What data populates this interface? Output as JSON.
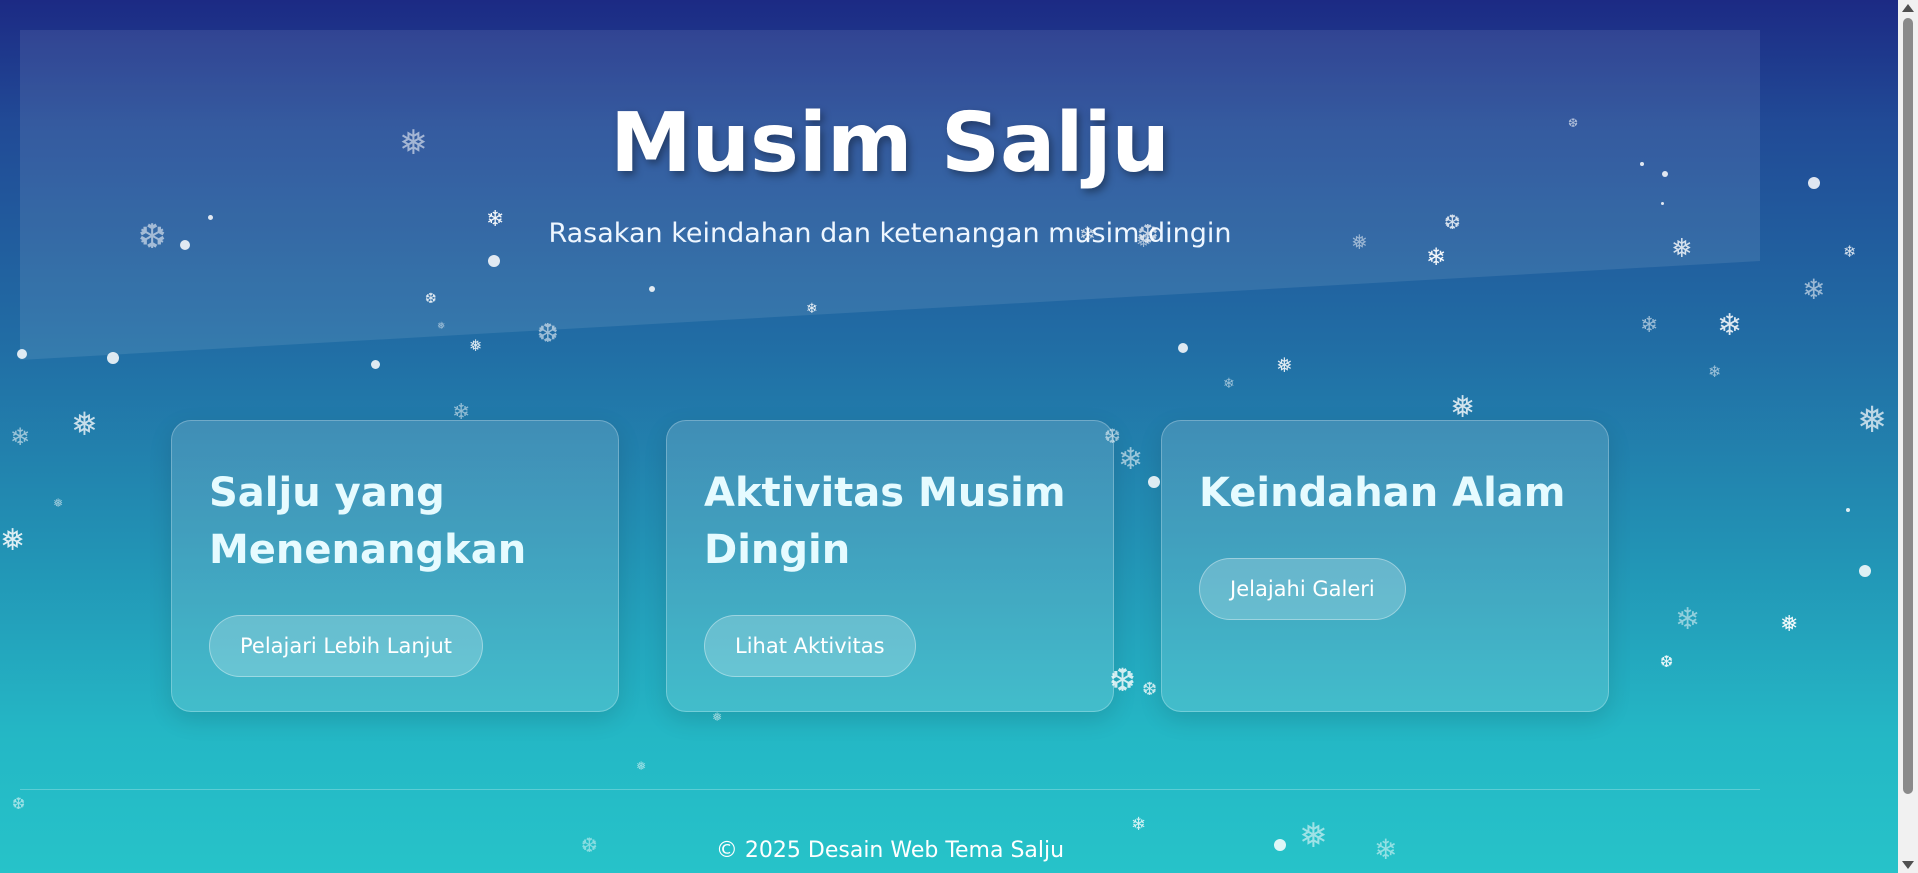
{
  "hero": {
    "title": "Musim Salju",
    "subtitle": "Rasakan keindahan dan ketenangan musim dingin"
  },
  "cards": [
    {
      "title": "Salju yang Menenangkan",
      "button": "Pelajari Lebih Lanjut"
    },
    {
      "title": "Aktivitas Musim Dingin",
      "button": "Lihat Aktivitas"
    },
    {
      "title": "Keindahan Alam",
      "button": "Jelajahi Galeri"
    }
  ],
  "footer": {
    "text": "© 2025 Desain Web Tema Salju"
  },
  "icons": {
    "snowflake": "❄",
    "snowflake_alt": "❅",
    "snowflake_heavy": "❆"
  },
  "colors": {
    "gradient_top": "#1c2a84",
    "gradient_bottom": "#26c3c9",
    "card_heading": "#e6fbff"
  }
}
